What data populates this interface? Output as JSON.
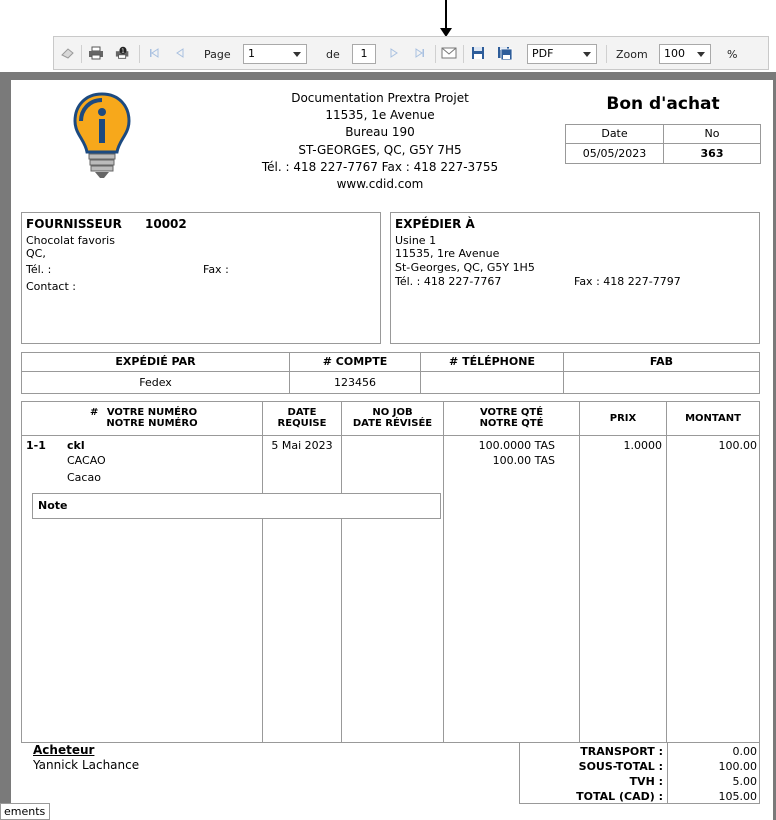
{
  "toolbar": {
    "page_label": "Page",
    "page_value": "1",
    "of_label": "de",
    "total_pages": "1",
    "export_format": "PDF",
    "zoom_label": "Zoom",
    "zoom_value": "100",
    "percent": "%"
  },
  "company": {
    "name": "Documentation Prextra Projet",
    "address1": "11535, 1e Avenue",
    "address2": "Bureau 190",
    "city": "ST-GEORGES, QC, G5Y 7H5",
    "phones": "Tél. : 418 227-7767 Fax : 418 227-3755",
    "website": "www.cdid.com"
  },
  "document": {
    "title": "Bon d'achat",
    "date_label": "Date",
    "no_label": "No",
    "date": "05/05/2023",
    "number": "363"
  },
  "supplier": {
    "label": "FOURNISSEUR",
    "code": "10002",
    "name": "Chocolat favoris",
    "region": "QC,",
    "tel_label": "Tél. :",
    "fax_label": "Fax :",
    "contact_label": "Contact :"
  },
  "ship_to": {
    "label": "EXPÉDIER À",
    "line1": "Usine 1",
    "line2": "11535, 1re Avenue",
    "line3": "St-Georges, QC, G5Y 1H5",
    "tel": "Tél. : 418 227-7767",
    "fax": "Fax : 418 227-7797"
  },
  "shipping": {
    "headers": [
      "EXPÉDIÉ PAR",
      "# COMPTE",
      "# TÉLÉPHONE",
      "FAB"
    ],
    "values": [
      "Fedex",
      "123456",
      "",
      ""
    ]
  },
  "items_table": {
    "col_num": "#",
    "col_your_number": "VOTRE NUMÉRO",
    "col_our_number": "NOTRE NUMÉRO",
    "col_date1": "DATE",
    "col_date2": "REQUISE",
    "col_job1": "NO JOB",
    "col_job2": "DATE RÉVISÉE",
    "col_qty1": "VOTRE QTÉ",
    "col_qty2": "NOTRE QTÉ",
    "col_price": "PRIX",
    "col_amount": "MONTANT",
    "rows": [
      {
        "num": "1-1",
        "code": "ckl",
        "desc1": "CACAO",
        "desc2": "Cacao",
        "date": "5 Mai 2023",
        "qty_yours": "100.0000 TAS",
        "qty_ours": "100.00 TAS",
        "price": "1.0000",
        "amount": "100.00"
      }
    ],
    "note_label": "Note"
  },
  "buyer": {
    "label": "Acheteur",
    "name": "Yannick Lachance"
  },
  "totals": {
    "transport_label": "TRANSPORT :",
    "transport": "0.00",
    "subtotal_label": "SOUS-TOTAL :",
    "subtotal": "100.00",
    "tax_label": "TVH :",
    "tax": "5.00",
    "total_label": "TOTAL (CAD) :",
    "total": "105.00"
  },
  "status_tab": "ements"
}
